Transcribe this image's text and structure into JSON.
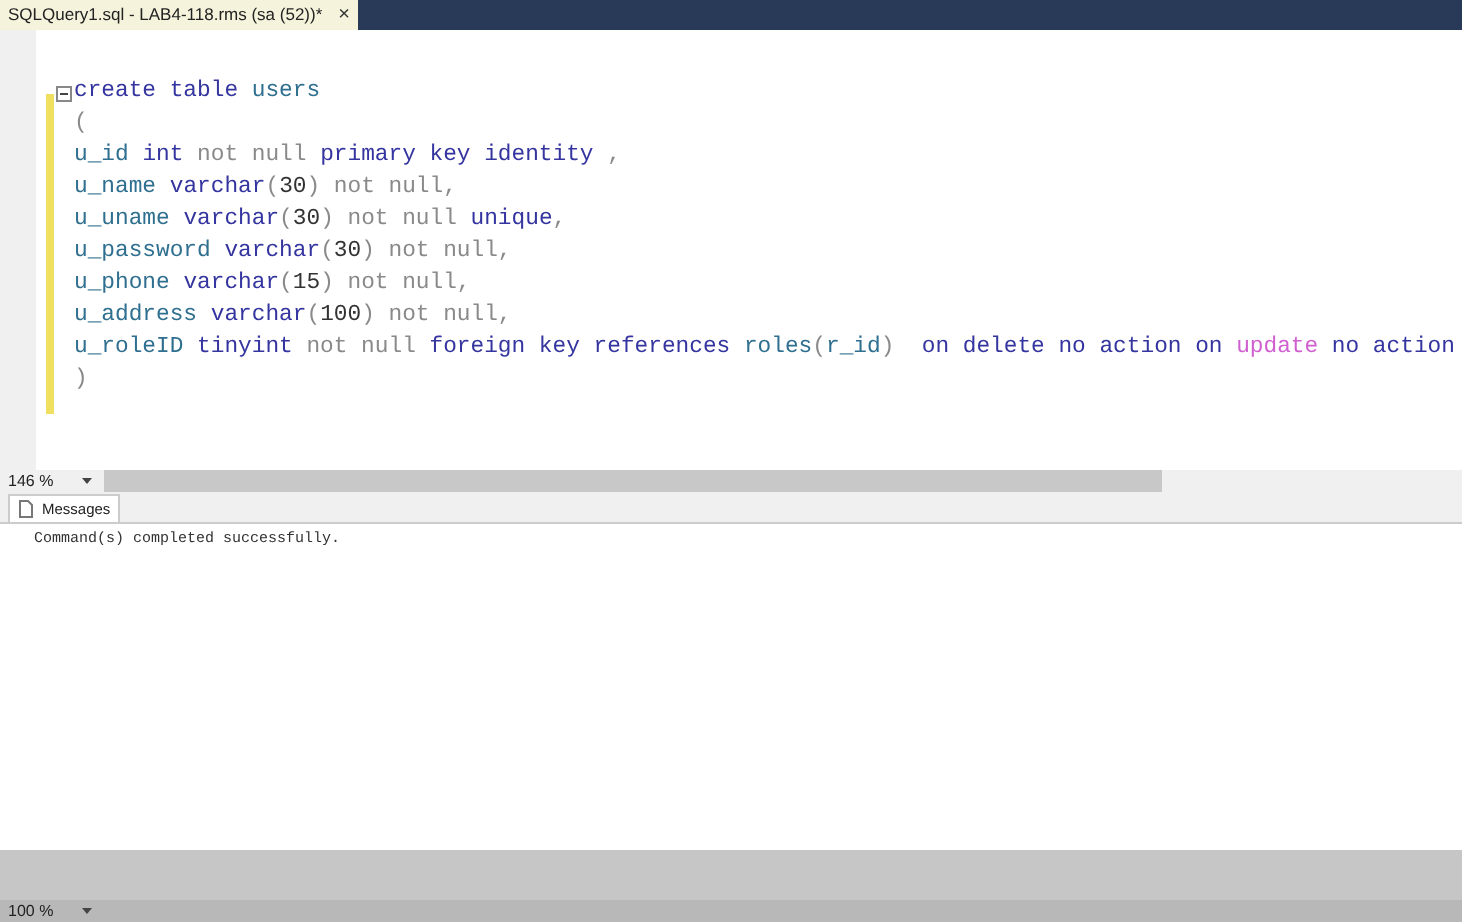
{
  "document_tab": {
    "title": "SQLQuery1.sql - LAB4-118.rms (sa (52))*",
    "close": "×"
  },
  "editor": {
    "lines": [
      {
        "fold": true,
        "tokens": [
          {
            "text": "create table ",
            "kind": "keyword"
          },
          {
            "text": "users",
            "kind": "identifier"
          }
        ]
      },
      {
        "fold": false,
        "tokens": [
          {
            "text": "(",
            "kind": "operator"
          }
        ]
      },
      {
        "fold": false,
        "tokens": [
          {
            "text": "u_id ",
            "kind": "identifier"
          },
          {
            "text": "int ",
            "kind": "keyword"
          },
          {
            "text": "not null ",
            "kind": "operator"
          },
          {
            "text": "primary key identity ",
            "kind": "keyword"
          },
          {
            "text": ",",
            "kind": "operator"
          }
        ]
      },
      {
        "fold": false,
        "tokens": [
          {
            "text": "u_name ",
            "kind": "identifier"
          },
          {
            "text": "varchar",
            "kind": "keyword"
          },
          {
            "text": "(",
            "kind": "operator"
          },
          {
            "text": "30",
            "kind": "plain"
          },
          {
            "text": ") not null,",
            "kind": "operator"
          }
        ]
      },
      {
        "fold": false,
        "tokens": [
          {
            "text": "u_uname ",
            "kind": "identifier"
          },
          {
            "text": "varchar",
            "kind": "keyword"
          },
          {
            "text": "(",
            "kind": "operator"
          },
          {
            "text": "30",
            "kind": "plain"
          },
          {
            "text": ") not null ",
            "kind": "operator"
          },
          {
            "text": "unique",
            "kind": "keyword"
          },
          {
            "text": ",",
            "kind": "operator"
          }
        ]
      },
      {
        "fold": false,
        "tokens": [
          {
            "text": "u_password ",
            "kind": "identifier"
          },
          {
            "text": "varchar",
            "kind": "keyword"
          },
          {
            "text": "(",
            "kind": "operator"
          },
          {
            "text": "30",
            "kind": "plain"
          },
          {
            "text": ") not null,",
            "kind": "operator"
          }
        ]
      },
      {
        "fold": false,
        "tokens": [
          {
            "text": "u_phone ",
            "kind": "identifier"
          },
          {
            "text": "varchar",
            "kind": "keyword"
          },
          {
            "text": "(",
            "kind": "operator"
          },
          {
            "text": "15",
            "kind": "plain"
          },
          {
            "text": ") not null,",
            "kind": "operator"
          }
        ]
      },
      {
        "fold": false,
        "tokens": [
          {
            "text": "u_address ",
            "kind": "identifier"
          },
          {
            "text": "varchar",
            "kind": "keyword"
          },
          {
            "text": "(",
            "kind": "operator"
          },
          {
            "text": "100",
            "kind": "plain"
          },
          {
            "text": ") not null,",
            "kind": "operator"
          }
        ]
      },
      {
        "fold": false,
        "tokens": [
          {
            "text": "u_roleID ",
            "kind": "identifier"
          },
          {
            "text": "tinyint ",
            "kind": "keyword"
          },
          {
            "text": "not null ",
            "kind": "operator"
          },
          {
            "text": "foreign key references ",
            "kind": "keyword"
          },
          {
            "text": "roles",
            "kind": "identifier"
          },
          {
            "text": "(",
            "kind": "operator"
          },
          {
            "text": "r_id",
            "kind": "identifier"
          },
          {
            "text": ")  ",
            "kind": "operator"
          },
          {
            "text": "on delete no action on ",
            "kind": "keyword"
          },
          {
            "text": "update",
            "kind": "function"
          },
          {
            "text": " no action",
            "kind": "keyword"
          }
        ]
      },
      {
        "fold": false,
        "tokens": [
          {
            "text": ")",
            "kind": "operator"
          }
        ]
      }
    ]
  },
  "editor_zoom": "146 %",
  "results": {
    "tabs": [
      {
        "label": "Messages",
        "selected": true
      }
    ],
    "messages": [
      "Command(s) completed successfully."
    ]
  },
  "results_zoom": "100 %"
}
